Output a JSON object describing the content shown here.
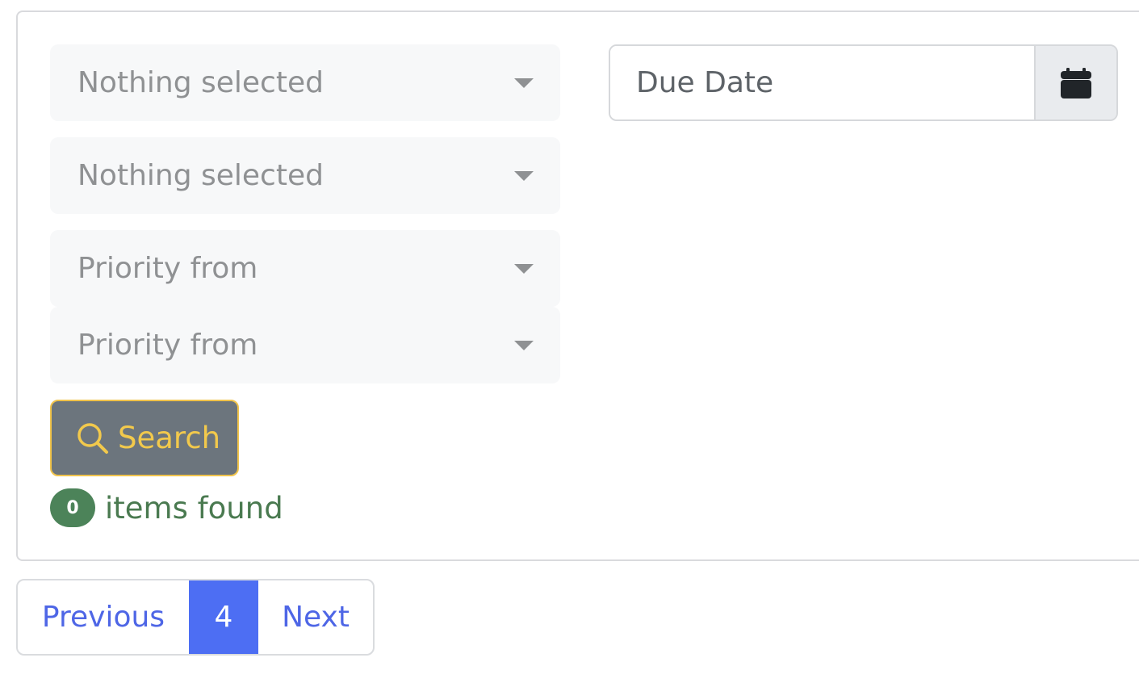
{
  "filters": {
    "select1": {
      "value": "Nothing selected"
    },
    "select2": {
      "value": "Nothing selected"
    },
    "select3": {
      "value": "Priority from"
    },
    "select4": {
      "value": "Priority from"
    },
    "due_date": {
      "placeholder": "Due Date",
      "icon": "calendar-icon"
    }
  },
  "search_button": {
    "label": "Search",
    "icon": "search-icon"
  },
  "results": {
    "count": "0",
    "label": "items found"
  },
  "pagination": {
    "previous": "Previous",
    "current": "4",
    "next": "Next"
  },
  "colors": {
    "search_button_bg": "#6c757d",
    "search_button_text": "#f2c94c",
    "badge_bg": "#4c8359",
    "found_text": "#4a7a50",
    "link": "#4e66e6",
    "active_page": "#4d6ef3"
  }
}
